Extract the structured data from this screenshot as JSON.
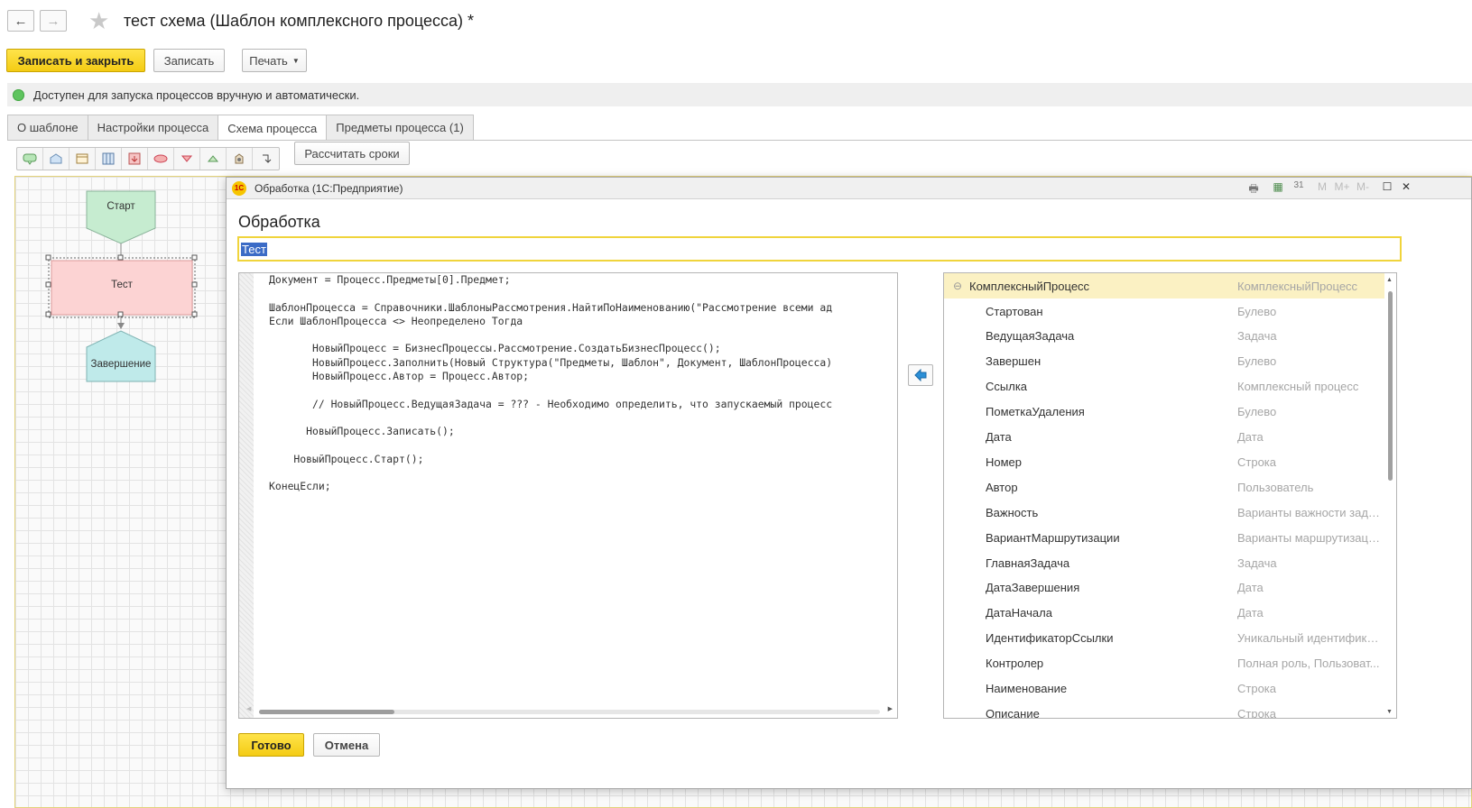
{
  "window": {
    "title": "тест схема (Шаблон комплексного процесса) *",
    "nav_back": "←",
    "nav_forward": "→",
    "favorite_icon": "star-icon"
  },
  "toolbar": {
    "save_close_label": "Записать и закрыть",
    "save_label": "Записать",
    "print_label": "Печать"
  },
  "status": {
    "text": "Доступен для запуска процессов вручную и автоматически.",
    "color": "#5ec45e"
  },
  "tabs": [
    {
      "label": "О шаблоне",
      "active": false
    },
    {
      "label": "Настройки процесса",
      "active": false
    },
    {
      "label": "Схема процесса",
      "active": true
    },
    {
      "label": "Предметы процесса (1)",
      "active": false
    }
  ],
  "schema_toolbar": {
    "icons": [
      "start-point-icon",
      "pentagon-point-icon",
      "form-point-icon",
      "column-point-icon",
      "subprocess-point-icon",
      "action-point-icon",
      "decision-point-icon",
      "merge-point-icon",
      "processing-point-icon",
      "connector-icon"
    ],
    "calc_button_label": "Рассчитать сроки"
  },
  "schema": {
    "start_label": "Старт",
    "task_label": "Тест",
    "end_label": "Завершение"
  },
  "dialog": {
    "window_title": "Обработка  (1С:Предприятие)",
    "heading": "Обработка",
    "name_value": "Тест",
    "code_lines": [
      "Документ = Процесс.Предметы[0].Предмет;",
      "",
      "ШаблонПроцесса = Справочники.ШаблоныРассмотрения.НайтиПоНаименованию(\"Рассмотрение всеми ад",
      "Если ШаблонПроцесса <> Неопределено Тогда",
      "",
      "       НовыйПроцесс = БизнесПроцессы.Рассмотрение.СоздатьБизнесПроцесс();",
      "       НовыйПроцесс.Заполнить(Новый Структура(\"Предметы, Шаблон\", Документ, ШаблонПроцесса)",
      "       НовыйПроцесс.Автор = Процесс.Автор;",
      "",
      "       // НовыйПроцесс.ВедущаяЗадача = ??? - Необходимо определить, что запускаемый процесс",
      "",
      "      НовыйПроцесс.Записать();",
      "",
      "    НовыйПроцесс.Старт();",
      "",
      "КонецЕсли;"
    ],
    "tree_root": {
      "name": "КомплексныйПроцесс",
      "type": "КомплексныйПроцесс"
    },
    "tree_items": [
      {
        "name": "Стартован",
        "type": "Булево"
      },
      {
        "name": "ВедущаяЗадача",
        "type": "Задача"
      },
      {
        "name": "Завершен",
        "type": "Булево"
      },
      {
        "name": "Ссылка",
        "type": "Комплексный процесс"
      },
      {
        "name": "ПометкаУдаления",
        "type": "Булево"
      },
      {
        "name": "Дата",
        "type": "Дата"
      },
      {
        "name": "Номер",
        "type": "Строка"
      },
      {
        "name": "Автор",
        "type": "Пользователь"
      },
      {
        "name": "Важность",
        "type": "Варианты важности зада..."
      },
      {
        "name": "ВариантМаршрутизации",
        "type": "Варианты маршрутизаци..."
      },
      {
        "name": "ГлавнаяЗадача",
        "type": "Задача"
      },
      {
        "name": "ДатаЗавершения",
        "type": "Дата"
      },
      {
        "name": "ДатаНачала",
        "type": "Дата"
      },
      {
        "name": "ИдентификаторСсылки",
        "type": "Уникальный идентификат..."
      },
      {
        "name": "Контролер",
        "type": "Полная роль, Пользоват..."
      },
      {
        "name": "Наименование",
        "type": "Строка"
      },
      {
        "name": "Описание",
        "type": "Строка"
      }
    ],
    "ok_label": "Готово",
    "cancel_label": "Отмена"
  }
}
